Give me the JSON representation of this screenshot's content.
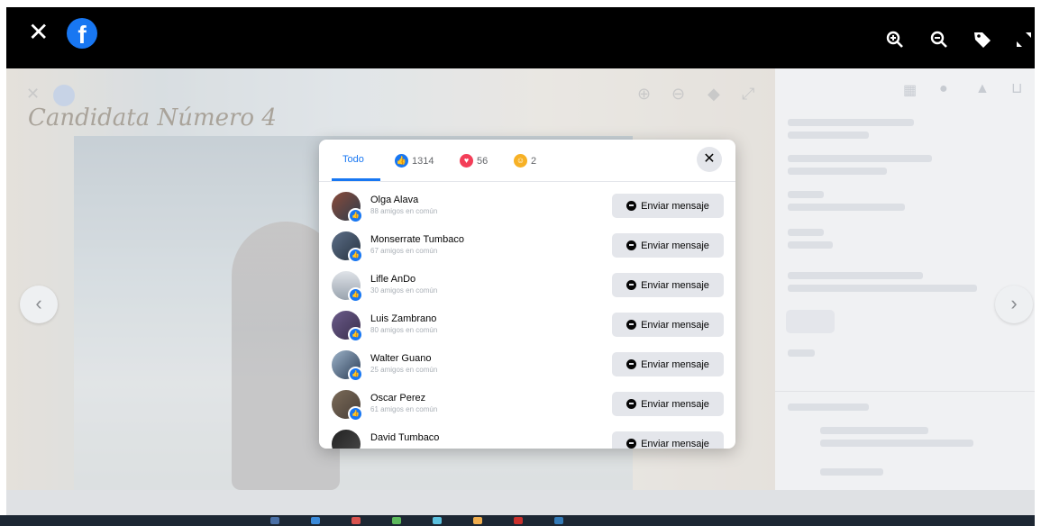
{
  "viewer": {
    "photo_caption": "Candidata Número 4"
  },
  "reactions_dialog": {
    "tabs": [
      {
        "label": "Todo",
        "icon": "none",
        "active": true
      },
      {
        "label": "1314",
        "icon": "like-reaction-icon"
      },
      {
        "label": "56",
        "icon": "love-reaction-icon"
      },
      {
        "label": "2",
        "icon": "care-reaction-icon"
      }
    ],
    "people": [
      {
        "name": "Olga Alava",
        "mutual": "88 amigos en común",
        "button": "Enviar mensaje"
      },
      {
        "name": "Monserrate Tumbaco",
        "mutual": "67 amigos en común",
        "button": "Enviar mensaje"
      },
      {
        "name": "Lifle AnDo",
        "mutual": "30 amigos en común",
        "button": "Enviar mensaje"
      },
      {
        "name": "Luis Zambrano",
        "mutual": "80 amigos en común",
        "button": "Enviar mensaje"
      },
      {
        "name": "Walter Guano",
        "mutual": "25 amigos en común",
        "button": "Enviar mensaje"
      },
      {
        "name": "Oscar Perez",
        "mutual": "61 amigos en común",
        "button": "Enviar mensaje"
      },
      {
        "name": "David Tumbaco",
        "mutual": "",
        "button": "Enviar mensaje"
      }
    ]
  },
  "colors": {
    "facebook_blue": "#1877f2",
    "love_red": "#f33e58",
    "care_yellow": "#f7b125",
    "button_gray": "#e4e6eb"
  }
}
